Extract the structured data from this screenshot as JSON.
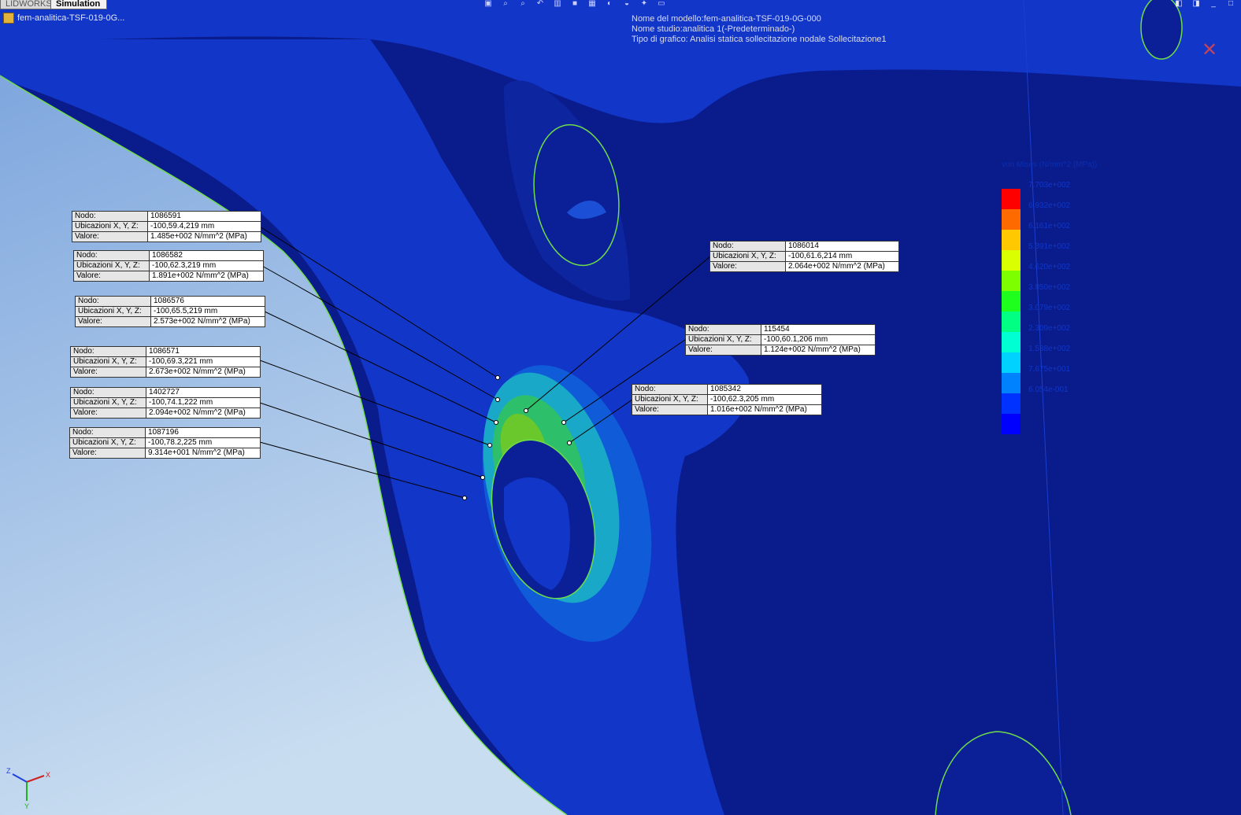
{
  "tabs": {
    "solidworks": "LIDWORKS",
    "simulation": "Simulation"
  },
  "tree": {
    "node_label": "fem-analitica-TSF-019-0G..."
  },
  "header_info": [
    "Nome del modello:fem-analitica-TSF-019-0G-000",
    "Nome studio:analitica 1(-Predeterminado-)",
    "Tipo di grafico: Analisi statica sollecitazione nodale Sollecitazione1"
  ],
  "toolbar": [
    "view-orient-icon",
    "zoom-fit-icon",
    "zoom-area-icon",
    "previous-view-icon",
    "section-view-icon",
    "display-style-icon",
    "hide-show-icon",
    "edit-appearance-icon",
    "scene-icon",
    "view-settings-icon",
    "display-icon"
  ],
  "legend": {
    "title": "von Mises (N/mm^2 (MPa))",
    "labels": [
      "7.703e+002",
      "6.932e+002",
      "6.161e+002",
      "5.391e+002",
      "4.620e+002",
      "3.850e+002",
      "3.079e+002",
      "2.309e+002",
      "1.538e+002",
      "7.675e+001",
      "6.054e-001"
    ],
    "colors": [
      "#ff0000",
      "#ff6a00",
      "#ffc800",
      "#d9ff00",
      "#7dff00",
      "#1eff1e",
      "#00ff82",
      "#00ffd2",
      "#00d2ff",
      "#0082ff",
      "#0032ff",
      "#0000ff"
    ]
  },
  "probe_labels": {
    "node": "Nodo:",
    "loc": "Ubicazioni X, Y, Z:",
    "value": "Valore:"
  },
  "probes": [
    {
      "node": "1086591",
      "loc": "-100,59.4,219 mm",
      "value": "1.485e+002 N/mm^2 (MPa)"
    },
    {
      "node": "1086582",
      "loc": "-100,62.3,219 mm",
      "value": "1.891e+002 N/mm^2 (MPa)"
    },
    {
      "node": "1086576",
      "loc": "-100,65.5,219 mm",
      "value": "2.573e+002 N/mm^2 (MPa)"
    },
    {
      "node": "1086571",
      "loc": "-100,69.3,221 mm",
      "value": "2.673e+002 N/mm^2 (MPa)"
    },
    {
      "node": "1402727",
      "loc": "-100,74.1,222 mm",
      "value": "2.094e+002 N/mm^2 (MPa)"
    },
    {
      "node": "1087196",
      "loc": "-100,78.2,225 mm",
      "value": "9.314e+001 N/mm^2 (MPa)"
    },
    {
      "node": "1086014",
      "loc": "-100,61.6,214 mm",
      "value": "2.064e+002 N/mm^2 (MPa)"
    },
    {
      "node": "115454",
      "loc": "-100,60.1,206 mm",
      "value": "1.124e+002 N/mm^2 (MPa)"
    },
    {
      "node": "1085342",
      "loc": "-100,62.3,205 mm",
      "value": "1.016e+002 N/mm^2 (MPa)"
    }
  ],
  "triad": {
    "x": "X",
    "y": "Y",
    "z": "Z"
  },
  "colors": {
    "part_dark": "#0a1b8c",
    "part_mid": "#1236c8",
    "background_top": "#7fa7de",
    "background_bottom": "#c9ddf0",
    "edge": "#6fdc4a"
  }
}
